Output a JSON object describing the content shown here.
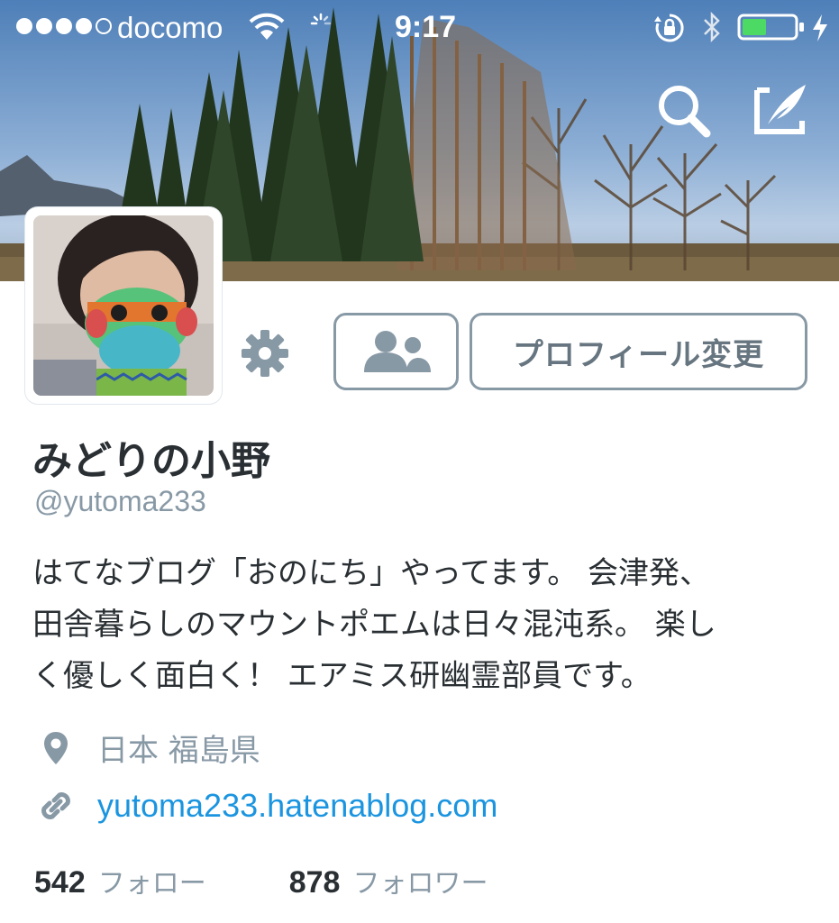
{
  "status_bar": {
    "signal_bars_filled": 4,
    "signal_bars_total": 5,
    "carrier": "docomo",
    "time": "9:17",
    "battery_level": 0.4,
    "battery_color": "#4cd964"
  },
  "header": {
    "search_icon": "search-icon",
    "compose_icon": "compose-tweet-icon"
  },
  "profile": {
    "settings_icon": "gear-icon",
    "people_icon": "people-icon",
    "edit_profile_label": "プロフィール変更",
    "display_name": "みどりの小野",
    "handle": "@yutoma233",
    "bio": "はてなブログ「おのにち」やってます。 会津発、\n田舎暮らしのマウントポエムは日々混沌系。 楽し\nく優しく面白く！ エアミス研幽霊部員です。",
    "location_icon": "location-pin-icon",
    "location": "日本 福島県",
    "url_icon": "link-icon",
    "url": "yutoma233.hatenablog.com",
    "following_count": "542",
    "following_label": "フォロー",
    "followers_count": "878",
    "followers_label": "フォロワー"
  },
  "colors": {
    "link": "#1b95e0",
    "secondary_text": "#8899a6",
    "button_border": "#8899a6",
    "primary_text": "#292f33"
  }
}
